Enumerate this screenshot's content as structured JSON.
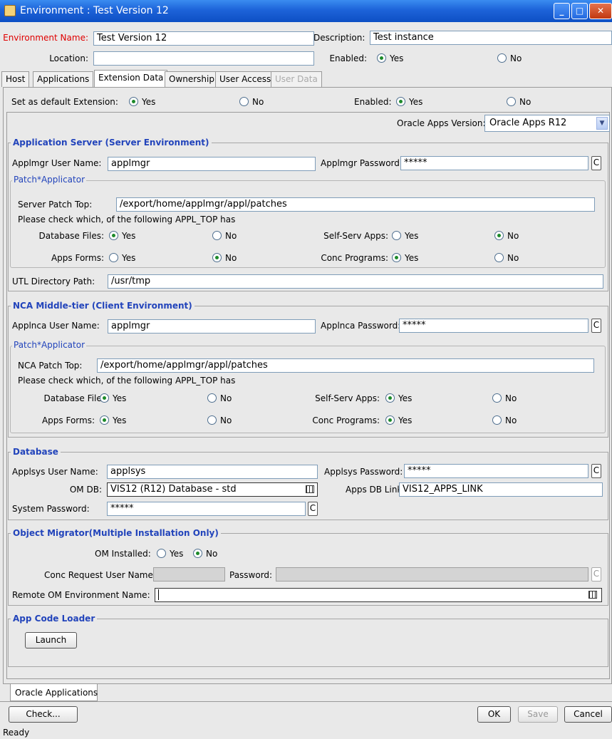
{
  "window": {
    "title": "Environment : Test Version 12",
    "controls": [
      "minimize-icon",
      "maximize-icon",
      "close-icon"
    ],
    "accent_color": "#1d63d9"
  },
  "header": {
    "env_name_label": "Environment Name:",
    "env_name_value": "Test Version 12",
    "description_label": "Description:",
    "description_value": "Test instance",
    "location_label": "Location:",
    "location_value": "",
    "enabled_label": "Enabled:",
    "enabled_yes": "Yes",
    "enabled_no": "No"
  },
  "tabs": [
    {
      "label": "Host"
    },
    {
      "label": "Applications"
    },
    {
      "label": "Extension Data",
      "selected": true
    },
    {
      "label": "Ownership"
    },
    {
      "label": "User Access"
    },
    {
      "label": "User Data",
      "disabled": true
    }
  ],
  "extension": {
    "default_label": "Set as default Extension:",
    "yes": "Yes",
    "no": "No",
    "enabled_label": "Enabled:",
    "version_label": "Oracle Apps Version:",
    "version_value": "Oracle Apps R12"
  },
  "app_server": {
    "title": "Application Server (Server Environment)",
    "user_label": "Applmgr User Name:",
    "user_value": "applmgr",
    "password_label": "Applmgr Password:",
    "password_value": "*****",
    "patch_title": "Patch*Applicator",
    "patch_top_label": "Server Patch Top:",
    "patch_top_value": "/export/home/applmgr/appl/patches",
    "check_text": "Please check which, of the following APPL_TOP has",
    "db_files_label": "Database Files:",
    "self_serv_label": "Self-Serv Apps:",
    "apps_forms_label": "Apps Forms:",
    "conc_label": "Conc Programs:",
    "yes": "Yes",
    "no": "No",
    "utl_label": "UTL Directory Path:",
    "utl_value": "/usr/tmp"
  },
  "nca": {
    "title": "NCA Middle-tier (Client Environment)",
    "user_label": "Applnca User Name:",
    "user_value": "applmgr",
    "password_label": "Applnca Password:",
    "password_value": "*****",
    "patch_title": "Patch*Applicator",
    "patch_top_label": "NCA Patch Top:",
    "patch_top_value": "/export/home/applmgr/appl/patches",
    "check_text": "Please check which, of the following APPL_TOP has",
    "db_files_label": "Database Files:",
    "self_serv_label": "Self-Serv Apps:",
    "apps_forms_label": "Apps Forms:",
    "conc_label": "Conc Programs:",
    "yes": "Yes",
    "no": "No"
  },
  "database": {
    "title": "Database",
    "user_label": "Applsys User Name:",
    "user_value": "applsys",
    "password_label": "Applsys Password:",
    "password_value": "*****",
    "omdb_label": "OM DB:",
    "omdb_value": "VIS12 (R12) Database - std",
    "link_label": "Apps DB Link:",
    "link_value": "VIS12_APPS_LINK",
    "sys_password_label": "System Password:",
    "sys_password_value": "*****"
  },
  "object_migrator": {
    "title": "Object Migrator(Multiple Installation Only)",
    "installed_label": "OM Installed:",
    "yes": "Yes",
    "no": "No",
    "conc_user_label": "Conc Request User Name:",
    "password_label": "Password:",
    "remote_label": "Remote OM Environment Name:"
  },
  "app_code_loader": {
    "title": "App Code Loader",
    "launch_label": "Launch"
  },
  "bottom_tab": "Oracle Applications",
  "footer": {
    "check_label": "Check...",
    "ok_label": "OK",
    "save_label": "Save",
    "cancel_label": "Cancel",
    "status": "Ready"
  },
  "c_button": "C"
}
